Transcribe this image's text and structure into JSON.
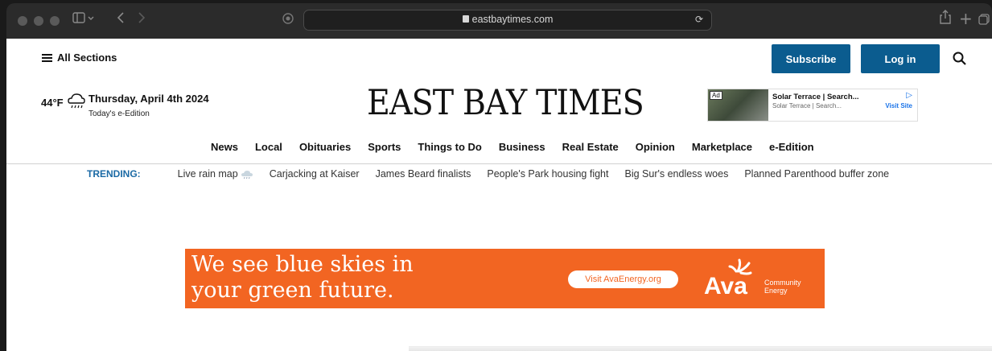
{
  "browser": {
    "url": "eastbaytimes.com"
  },
  "header": {
    "all_sections": "All Sections",
    "subscribe": "Subscribe",
    "login": "Log in"
  },
  "weather": {
    "temp": "44°F",
    "date": "Thursday, April 4th 2024",
    "edition_link": "Today's e-Edition"
  },
  "masthead": "EAST BAY TIMES",
  "ad_small": {
    "tag": "Ad",
    "title": "Solar Terrace | Search...",
    "subtitle": "Solar Terrace | Search...",
    "cta": "Visit Site"
  },
  "nav": [
    "News",
    "Local",
    "Obituaries",
    "Sports",
    "Things to Do",
    "Business",
    "Real Estate",
    "Opinion",
    "Marketplace",
    "e-Edition"
  ],
  "trending": {
    "label": "TRENDING:",
    "items": [
      "Live rain map",
      "Carjacking at Kaiser",
      "James Beard finalists",
      "People's Park housing fight",
      "Big Sur's endless woes",
      "Planned Parenthood buffer zone"
    ]
  },
  "banner": {
    "headline_line1": "We see blue skies in",
    "headline_line2": "your green future.",
    "cta": "Visit AvaEnergy.org",
    "brand": "Ava",
    "brand_sub_line1": "Community",
    "brand_sub_line2": "Energy",
    "color": "#f26522"
  }
}
